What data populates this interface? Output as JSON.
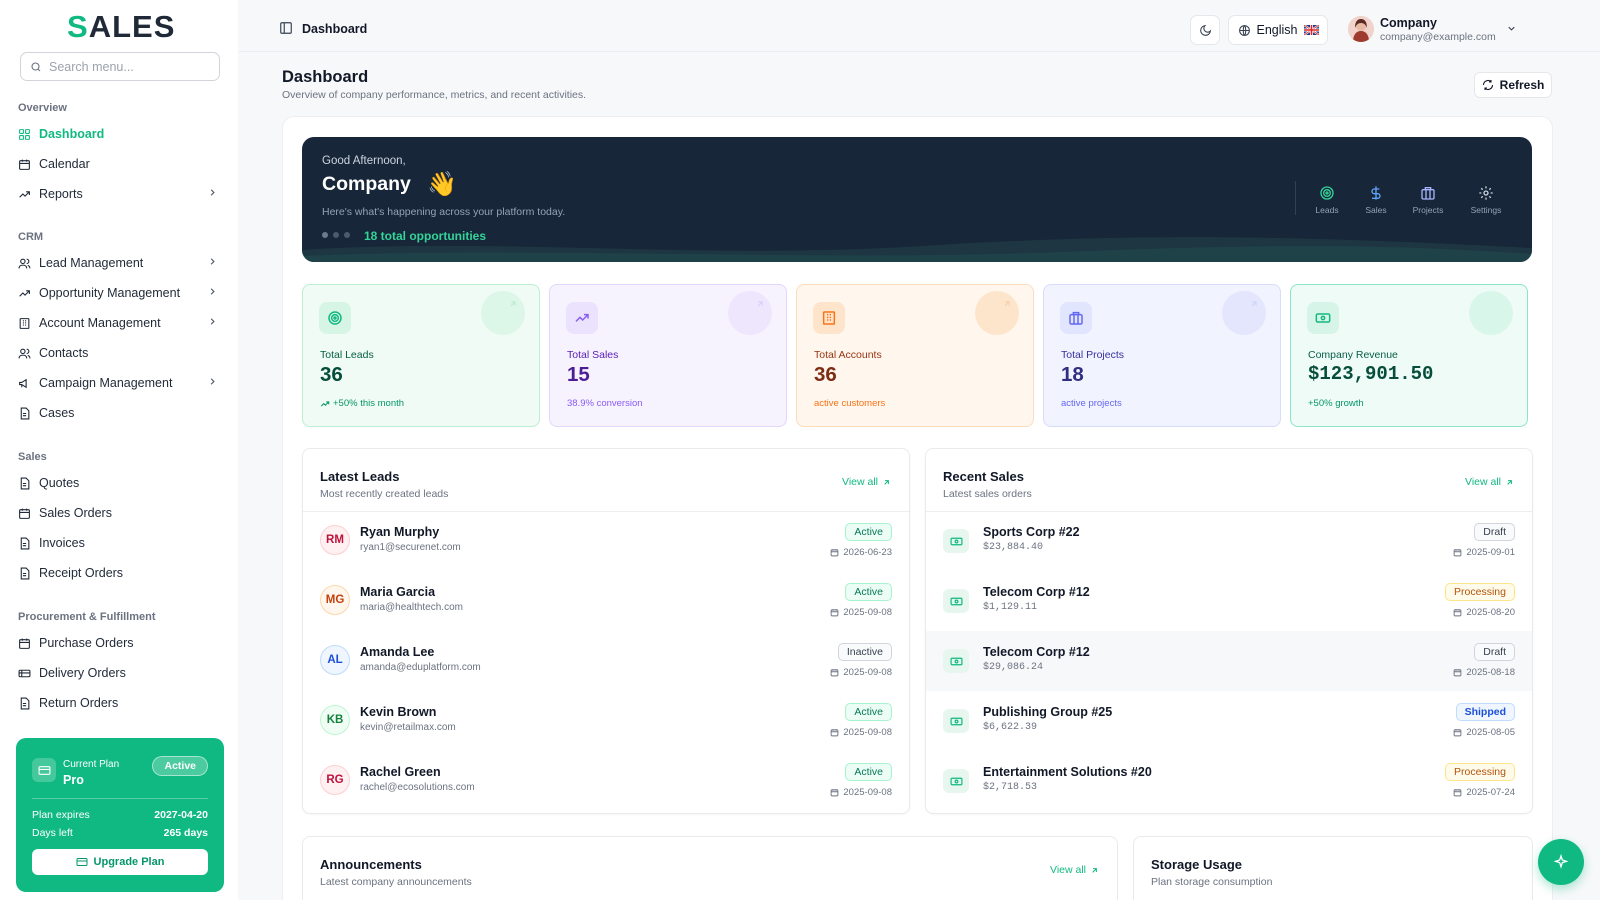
{
  "app": {
    "logo": "SALES"
  },
  "sidebar": {
    "search_placeholder": "Search menu...",
    "groups": [
      {
        "title": "Overview",
        "items": [
          {
            "label": "Dashboard",
            "icon": "grid-icon",
            "active": true
          },
          {
            "label": "Calendar",
            "icon": "calendar-icon"
          },
          {
            "label": "Reports",
            "icon": "trend-icon",
            "chevron": true
          }
        ]
      },
      {
        "title": "CRM",
        "items": [
          {
            "label": "Lead Management",
            "icon": "users-icon",
            "chevron": true
          },
          {
            "label": "Opportunity Management",
            "icon": "trend-icon",
            "chevron": true
          },
          {
            "label": "Account Management",
            "icon": "building-icon",
            "chevron": true
          },
          {
            "label": "Contacts",
            "icon": "users-icon"
          },
          {
            "label": "Campaign Management",
            "icon": "megaphone-icon",
            "chevron": true
          },
          {
            "label": "Cases",
            "icon": "file-icon"
          }
        ]
      },
      {
        "title": "Sales",
        "items": [
          {
            "label": "Quotes",
            "icon": "file-icon"
          },
          {
            "label": "Sales Orders",
            "icon": "calendar-icon"
          },
          {
            "label": "Invoices",
            "icon": "file-icon"
          },
          {
            "label": "Receipt Orders",
            "icon": "file-icon"
          }
        ]
      },
      {
        "title": "Procurement & Fulfillment",
        "items": [
          {
            "label": "Purchase Orders",
            "icon": "calendar-icon"
          },
          {
            "label": "Delivery Orders",
            "icon": "truck-icon"
          },
          {
            "label": "Return Orders",
            "icon": "file-icon"
          }
        ]
      }
    ],
    "plan": {
      "label": "Current Plan",
      "name": "Pro",
      "status": "Active",
      "expires_label": "Plan expires",
      "expires_value": "2027-04-20",
      "days_label": "Days left",
      "days_value": "265 days",
      "upgrade_label": "Upgrade Plan"
    }
  },
  "header": {
    "title": "Dashboard",
    "language": "English",
    "user_name": "Company",
    "user_email": "company@example.com"
  },
  "page": {
    "title": "Dashboard",
    "subtitle": "Overview of company performance, metrics, and recent activities.",
    "refresh_label": "Refresh"
  },
  "hero": {
    "greeting": "Good Afternoon,",
    "name": "Company",
    "wave": "👋",
    "subtitle": "Here's what's happening across your platform today.",
    "opportunities": "18 total opportunities",
    "actions": [
      {
        "label": "Leads",
        "icon": "target-icon"
      },
      {
        "label": "Sales",
        "icon": "dollar-icon"
      },
      {
        "label": "Projects",
        "icon": "briefcase-icon"
      },
      {
        "label": "Settings",
        "icon": "gear-icon"
      }
    ]
  },
  "stats": [
    {
      "label": "Total Leads",
      "value": "36",
      "note": "+50% this month",
      "accent": "#10b981"
    },
    {
      "label": "Total Sales",
      "value": "15",
      "note": "38.9% conversion",
      "accent": "#8b5cf6"
    },
    {
      "label": "Total Accounts",
      "value": "36",
      "note": "active customers",
      "accent": "#f97316"
    },
    {
      "label": "Total Projects",
      "value": "18",
      "note": "active projects",
      "accent": "#6366f1"
    },
    {
      "label": "Company Revenue",
      "value": "$123,901.50",
      "note": "+50% growth",
      "accent": "#10b981"
    }
  ],
  "latest_leads": {
    "title": "Latest Leads",
    "subtitle": "Most recently created leads",
    "view_all": "View all",
    "rows": [
      {
        "initials": "RM",
        "name": "Ryan Murphy",
        "email": "ryan1@securenet.com",
        "status": "Active",
        "date": "2026-06-23"
      },
      {
        "initials": "MG",
        "name": "Maria Garcia",
        "email": "maria@healthtech.com",
        "status": "Active",
        "date": "2025-09-08"
      },
      {
        "initials": "AL",
        "name": "Amanda Lee",
        "email": "amanda@eduplatform.com",
        "status": "Inactive",
        "date": "2025-09-08"
      },
      {
        "initials": "KB",
        "name": "Kevin Brown",
        "email": "kevin@retailmax.com",
        "status": "Active",
        "date": "2025-09-08"
      },
      {
        "initials": "RG",
        "name": "Rachel Green",
        "email": "rachel@ecosolutions.com",
        "status": "Active",
        "date": "2025-09-08"
      }
    ]
  },
  "recent_sales": {
    "title": "Recent Sales",
    "subtitle": "Latest sales orders",
    "view_all": "View all",
    "rows": [
      {
        "name": "Sports Corp #22",
        "amount": "$23,884.40",
        "status": "Draft",
        "date": "2025-09-01"
      },
      {
        "name": "Telecom Corp #12",
        "amount": "$1,129.11",
        "status": "Processing",
        "date": "2025-08-20"
      },
      {
        "name": "Telecom Corp #12",
        "amount": "$29,086.24",
        "status": "Draft",
        "date": "2025-08-18"
      },
      {
        "name": "Publishing Group #25",
        "amount": "$6,622.39",
        "status": "Shipped",
        "date": "2025-08-05"
      },
      {
        "name": "Entertainment Solutions #20",
        "amount": "$2,718.53",
        "status": "Processing",
        "date": "2025-07-24"
      }
    ]
  },
  "announcements": {
    "title": "Announcements",
    "subtitle": "Latest company announcements",
    "view_all": "View all"
  },
  "storage": {
    "title": "Storage Usage",
    "subtitle": "Plan storage consumption"
  }
}
